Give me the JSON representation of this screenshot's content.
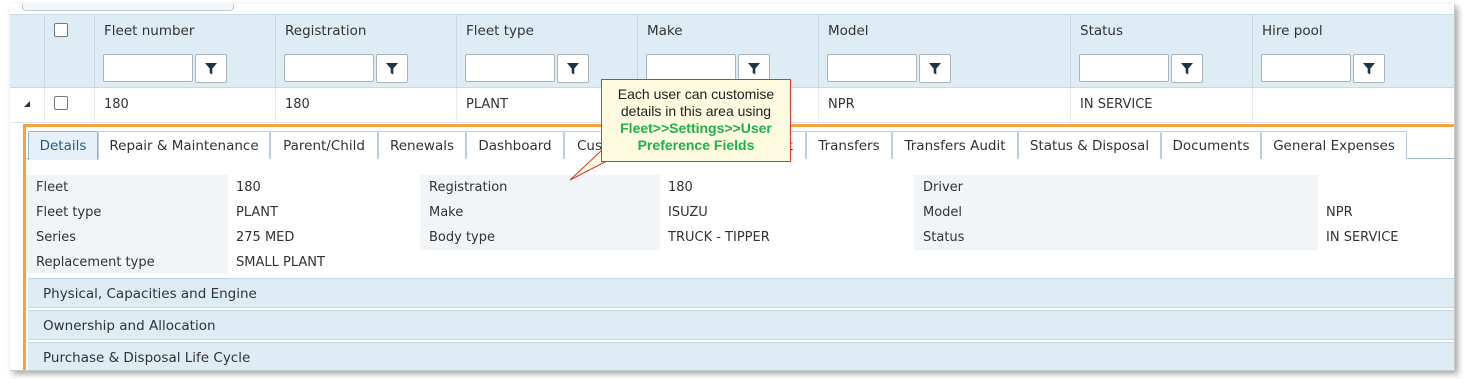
{
  "grid": {
    "columns": [
      "Fleet number",
      "Registration",
      "Fleet type",
      "Make",
      "Model",
      "Status",
      "Hire pool"
    ],
    "row": {
      "fleet_number": "180",
      "registration": "180",
      "fleet_type": "PLANT",
      "make": "",
      "model": "NPR",
      "status": "IN SERVICE",
      "hire_pool": ""
    }
  },
  "tabs": [
    {
      "label": "Details",
      "active": true
    },
    {
      "label": "Repair & Maintenance"
    },
    {
      "label": "Parent/Child"
    },
    {
      "label": "Renewals"
    },
    {
      "label": "Dashboard"
    },
    {
      "label": "Cus"
    },
    {
      "label": "t"
    },
    {
      "label": "Transfers"
    },
    {
      "label": "Transfers Audit"
    },
    {
      "label": "Status & Disposal"
    },
    {
      "label": "Documents"
    },
    {
      "label": "General Expenses"
    }
  ],
  "details": {
    "fleet_label": "Fleet",
    "fleet_value": "180",
    "registration_label": "Registration",
    "registration_value": "180",
    "driver_label": "Driver",
    "driver_value": "",
    "fleet_type_label": "Fleet type",
    "fleet_type_value": "PLANT",
    "make_label": "Make",
    "make_value": "ISUZU",
    "model_label": "Model",
    "model_value": "NPR",
    "series_label": "Series",
    "series_value": "275 MED",
    "body_type_label": "Body type",
    "body_type_value": "TRUCK - TIPPER",
    "status_label": "Status",
    "status_value": "IN SERVICE",
    "replacement_type_label": "Replacement type",
    "replacement_type_value": "SMALL PLANT"
  },
  "sections": [
    "Physical, Capacities and Engine",
    "Ownership and Allocation",
    "Purchase & Disposal Life Cycle"
  ],
  "callout": {
    "line1": "Each user can customise",
    "line2": "details in this area using",
    "line3": "Fleet>>Settings>>User",
    "line4": "Preference Fields"
  },
  "colors": {
    "accent": "#f5a33a",
    "header_bg": "#deecf6",
    "callout_border": "#d23a2a",
    "callout_highlight": "#1db34a"
  },
  "icons": {
    "filter": "filter-icon",
    "expand": "collapse-arrow-icon"
  }
}
